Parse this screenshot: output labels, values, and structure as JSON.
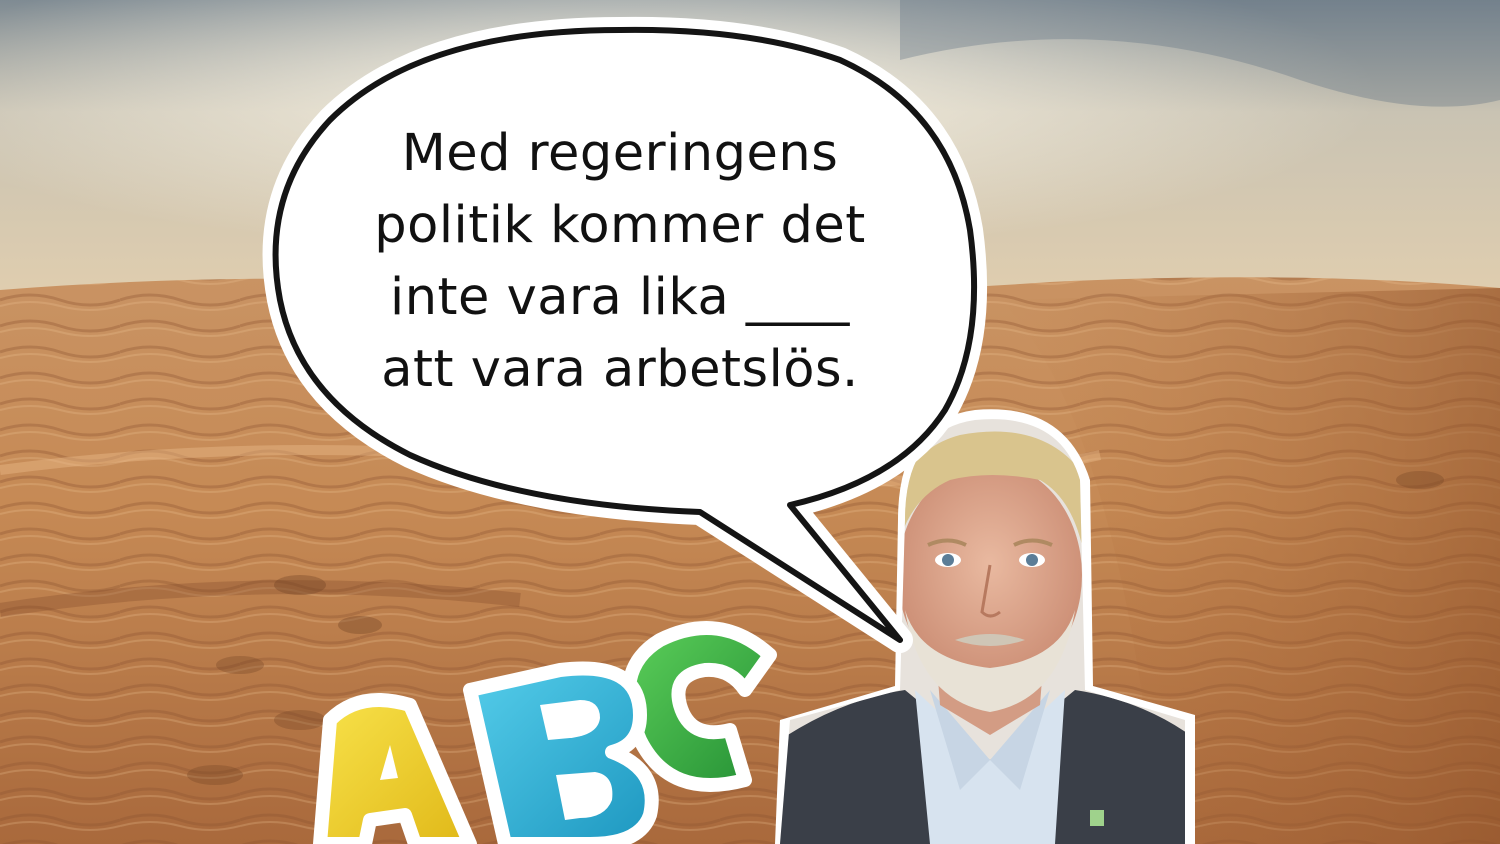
{
  "speech_bubble": {
    "lines": [
      "Med regeringens",
      "politik kommer det",
      "inte vara lika ____",
      "att vara arbetslös."
    ]
  },
  "letters": [
    "A",
    "B",
    "C"
  ],
  "colors": {
    "sky_top": "#8e9aa3",
    "sky_bottom": "#d8c7a8",
    "sand_light": "#d5a46e",
    "sand_dark": "#9a5f33",
    "letter_a": "#f3d52b",
    "letter_b": "#2fb5d8",
    "letter_c": "#38b247",
    "suit": "#3a3f48",
    "shirt": "#d7e3ef"
  },
  "icons": [
    "speech-bubble",
    "abc-letters-graphic",
    "man-portrait-photo",
    "lapel-pin-icon"
  ]
}
